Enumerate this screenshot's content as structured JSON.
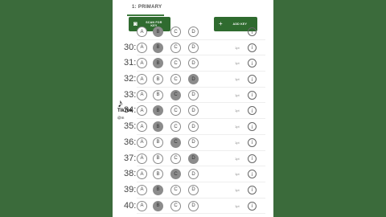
{
  "tab": {
    "label": "1: PRIMARY"
  },
  "buttons": {
    "scan": {
      "line1": "SCAN FOR",
      "line2": "KEY"
    },
    "add": {
      "plus": "+",
      "label": "ADD KEY"
    }
  },
  "rows": [
    {
      "num": "",
      "filled": "B",
      "tag": ""
    },
    {
      "num": "30:",
      "filled": "B",
      "tag": "1pt"
    },
    {
      "num": "31:",
      "filled": "B",
      "tag": "1pt"
    },
    {
      "num": "32:",
      "filled": "D",
      "tag": "1pt"
    },
    {
      "num": "33:",
      "filled": "C",
      "tag": "1pt"
    },
    {
      "num": "34:",
      "filled": "B",
      "tag": "1pt"
    },
    {
      "num": "35:",
      "filled": "B",
      "tag": "1pt"
    },
    {
      "num": "36:",
      "filled": "C",
      "tag": "1pt"
    },
    {
      "num": "37:",
      "filled": "D",
      "tag": "1pt"
    },
    {
      "num": "38:",
      "filled": "C",
      "tag": "1pt"
    },
    {
      "num": "39:",
      "filled": "B",
      "tag": "1pt"
    },
    {
      "num": "40:",
      "filled": "B",
      "tag": "1pt"
    }
  ],
  "choices": [
    "A",
    "B",
    "C",
    "D"
  ],
  "watermark": {
    "logo": "♪",
    "text": "TikTok",
    "user": "@m"
  },
  "colors": {
    "background": "#3b6b3b",
    "accent": "#2f6b2f",
    "filled_bubble": "#8c8c8c"
  }
}
